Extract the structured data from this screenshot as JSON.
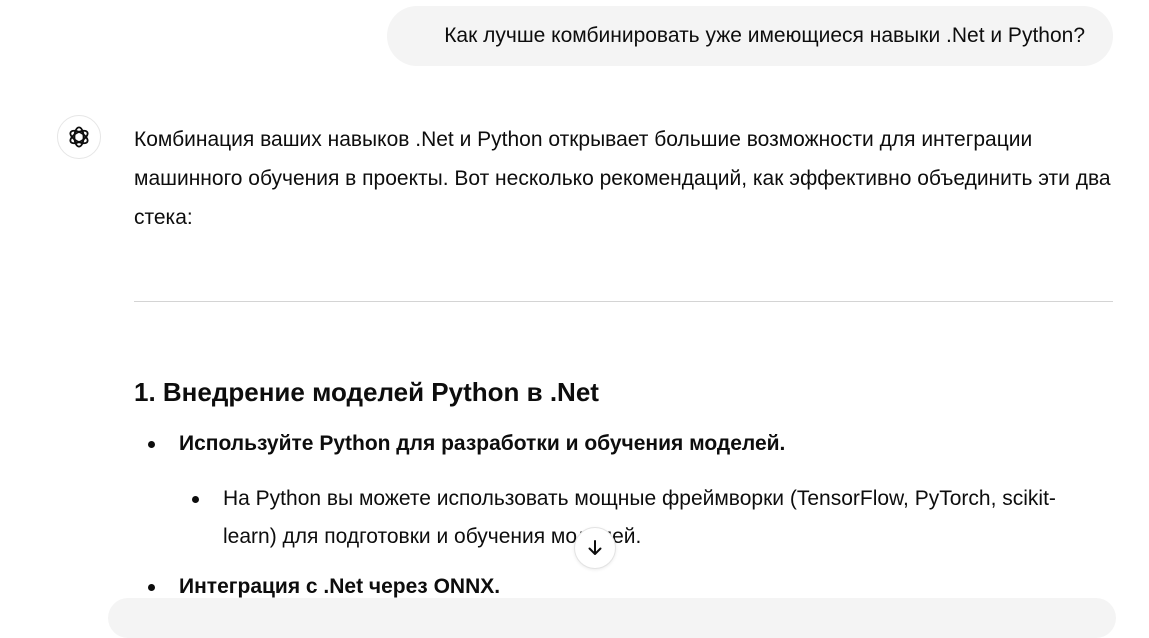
{
  "user_message": "Как лучше комбинировать уже имеющиеся навыки .Net и Python?",
  "assistant": {
    "avatar_icon": "openai-logo-icon",
    "intro": "Комбинация ваших навыков .Net и Python открывает большие возможности для интеграции машинного обучения в проекты. Вот несколько рекомендаций, как эффективно объединить эти два стека:",
    "section_heading": "1. Внедрение моделей Python в .Net",
    "bullets": [
      "Используйте Python для разработки и обучения моделей.",
      "На Python вы можете использовать мощные фреймворки (TensorFlow, PyTorch, scikit-learn) для подготовки и обучения моделей.",
      "Интеграция с .Net через ONNX."
    ]
  },
  "controls": {
    "scroll_down_icon": "arrow-down-icon"
  },
  "colors": {
    "user_bubble": "#f4f4f4",
    "text": "#0d0d0d",
    "divider": "#d4d4d4"
  }
}
